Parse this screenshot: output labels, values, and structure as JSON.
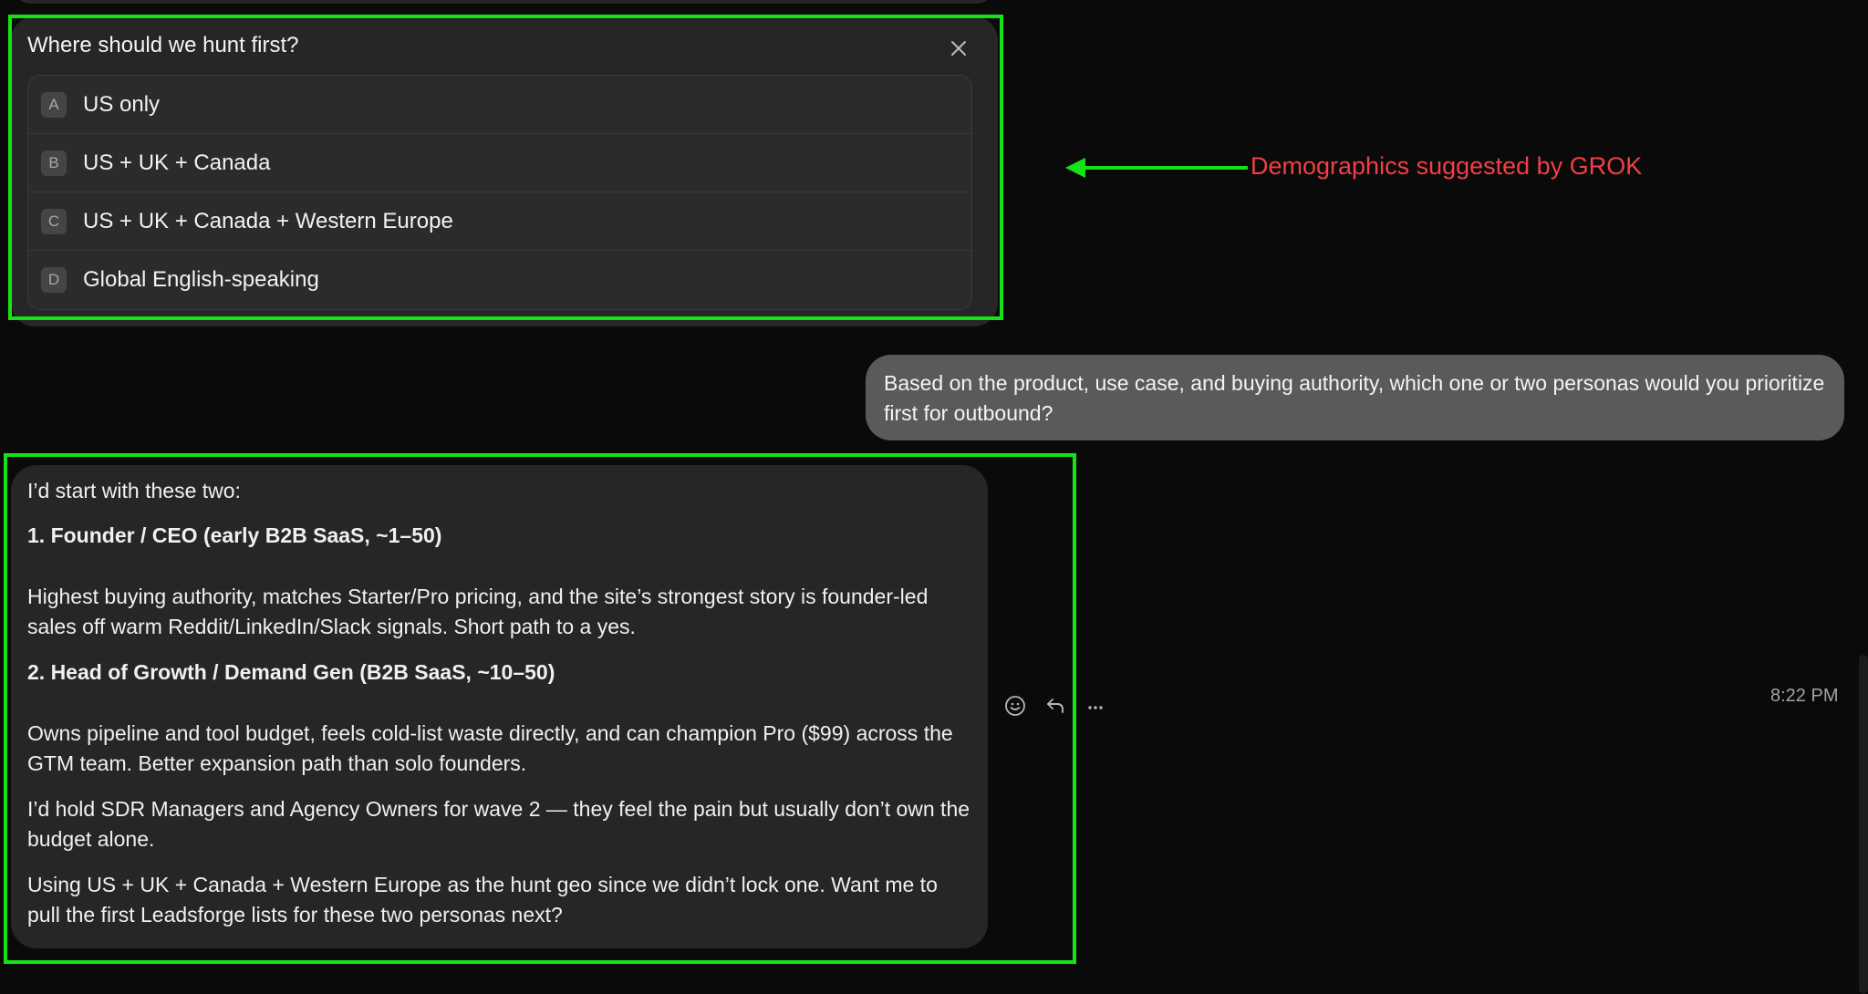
{
  "question": {
    "title": "Where should we hunt first?",
    "options": [
      {
        "letter": "A",
        "label": "US only"
      },
      {
        "letter": "B",
        "label": "US + UK + Canada"
      },
      {
        "letter": "C",
        "label": "US + UK + Canada + Western Europe"
      },
      {
        "letter": "D",
        "label": "Global English-speaking"
      }
    ]
  },
  "annotation": {
    "text": "Demographics suggested by GROK",
    "color": "#f33f45",
    "highlight_color": "#16e316"
  },
  "user_message": {
    "text": "Based on the product, use case, and buying authority, which one or two personas would you prioritize first for outbound?"
  },
  "assistant_message": {
    "intro": "I’d start with these two:",
    "persona1_heading": "1. Founder / CEO (early B2B SaaS, ~1–50)",
    "persona1_body": "Highest buying authority, matches Starter/Pro pricing, and the site’s strongest story is founder-led sales off warm Reddit/LinkedIn/Slack signals. Short path to a yes.",
    "persona2_heading": "2. Head of Growth / Demand Gen (B2B SaaS, ~10–50)",
    "persona2_body": "Owns pipeline and tool budget, feels cold-list waste directly, and can champion Pro ($99) across the GTM team. Better expansion path than solo founders.",
    "wave2": "I’d hold SDR Managers and Agency Owners for wave 2 — they feel the pain but usually don’t own the budget alone.",
    "closing": "Using US + UK + Canada + Western Europe as the hunt geo since we didn’t lock one. Want me to pull the first Leadsforge lists for these two personas next?"
  },
  "message_actions": {
    "icons": [
      "emoji-icon",
      "reply-icon",
      "more-icon"
    ],
    "timestamp": "8:22 PM"
  }
}
